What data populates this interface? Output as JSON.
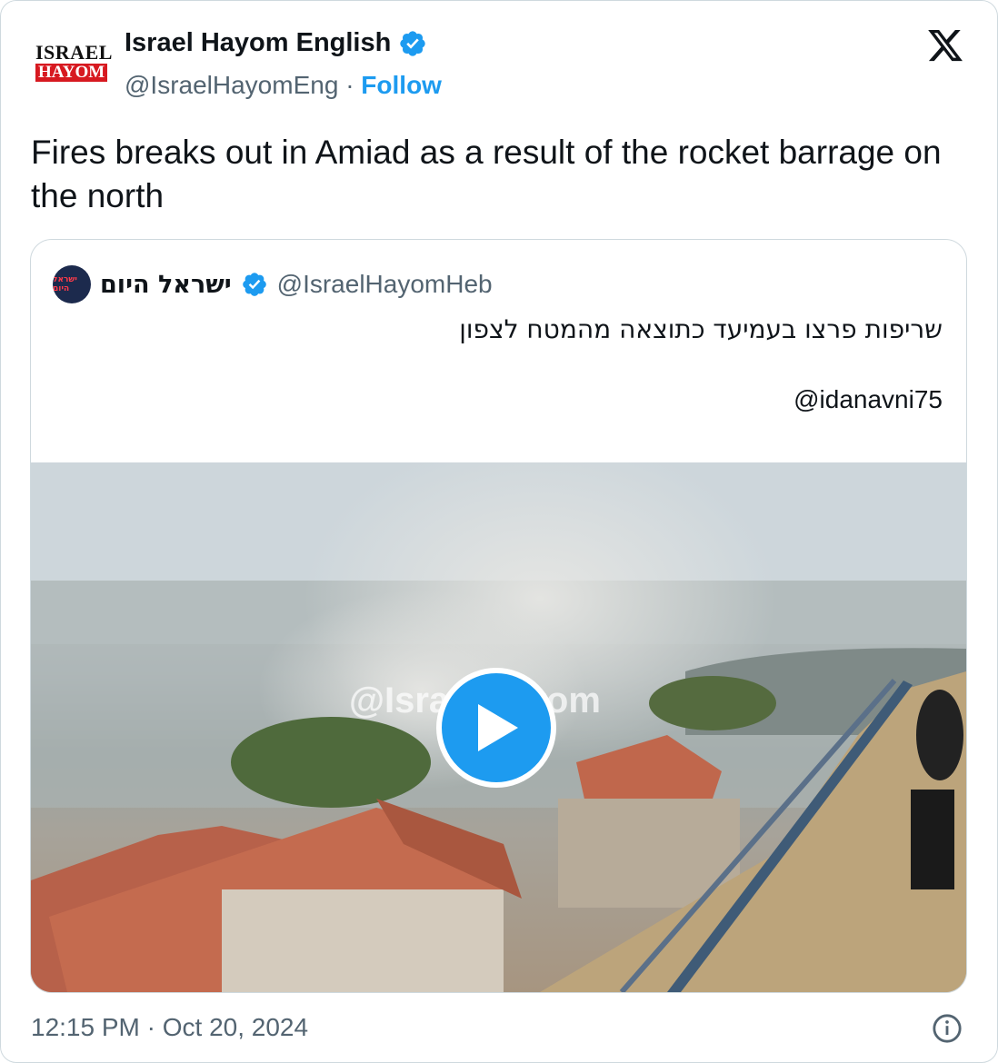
{
  "author": {
    "logo_line1": "ISRAEL",
    "logo_line2": "HAYOM",
    "name": "Israel Hayom English",
    "handle": "@IsraelHayomEng",
    "separator": "·",
    "follow_label": "Follow"
  },
  "tweet": {
    "text": "Fires breaks out in Amiad as a result of the rocket barrage on the north",
    "timestamp": "12:15 PM · Oct 20, 2024"
  },
  "quoted": {
    "name": "ישראל היום",
    "handle": "@IsraelHayomHeb",
    "avatar_text": "ישראל היום",
    "text": "שריפות פרצו בעמיעד כתוצאה מהמטח לצפון",
    "mention": "@idanavni75",
    "video_watermark": "@IsraelHayom"
  },
  "colors": {
    "accent": "#1d9bf0",
    "muted": "#536471",
    "brand_red": "#d71920"
  },
  "icons": [
    "verified-badge-icon",
    "x-logo-icon",
    "play-icon",
    "info-icon"
  ]
}
